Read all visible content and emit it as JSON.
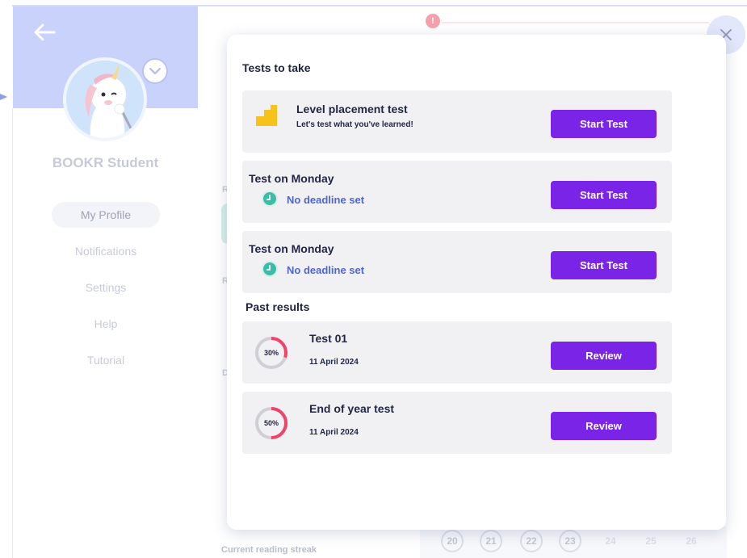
{
  "sidebar": {
    "student_name": "BOOKR Student",
    "items": [
      {
        "label": "My Profile",
        "active": true
      },
      {
        "label": "Notifications",
        "active": false
      },
      {
        "label": "Settings",
        "active": false
      },
      {
        "label": "Help",
        "active": false
      },
      {
        "label": "Tutorial",
        "active": false
      }
    ]
  },
  "background": {
    "alert_icon": "!",
    "ghost_letters": [
      "R",
      "R",
      "D"
    ],
    "streak_label": "Current reading streak",
    "calendar_days": [
      "20",
      "21",
      "22",
      "23",
      "24",
      "25",
      "26"
    ]
  },
  "modal": {
    "tests_title": "Tests to take",
    "tests": [
      {
        "title": "Level placement test",
        "subtitle": "Let's test what you've learned!",
        "button": "Start Test",
        "icon": "stairs-icon"
      },
      {
        "title": "Test on Monday",
        "deadline": "No deadline set",
        "button": "Start Test",
        "icon": "clock-icon"
      },
      {
        "title": "Test on Monday",
        "deadline": "No deadline set",
        "button": "Start Test",
        "icon": "clock-icon"
      }
    ],
    "past_title": "Past results",
    "results": [
      {
        "title": "Test 01",
        "date": "11 April 2024",
        "score_label": "30%",
        "score": 30,
        "button": "Review"
      },
      {
        "title": "End of year test",
        "date": "11 April 2024",
        "score_label": "50%",
        "score": 50,
        "button": "Review"
      }
    ]
  },
  "colors": {
    "accent": "#7a24e8",
    "deadline_text": "#4f66d6",
    "clock": "#3dbca5",
    "stairs": "#f7c21b",
    "donut_score": "#f0436a",
    "donut_track": "#cfcfd4",
    "sidebar_header": "#c9d2fb"
  }
}
